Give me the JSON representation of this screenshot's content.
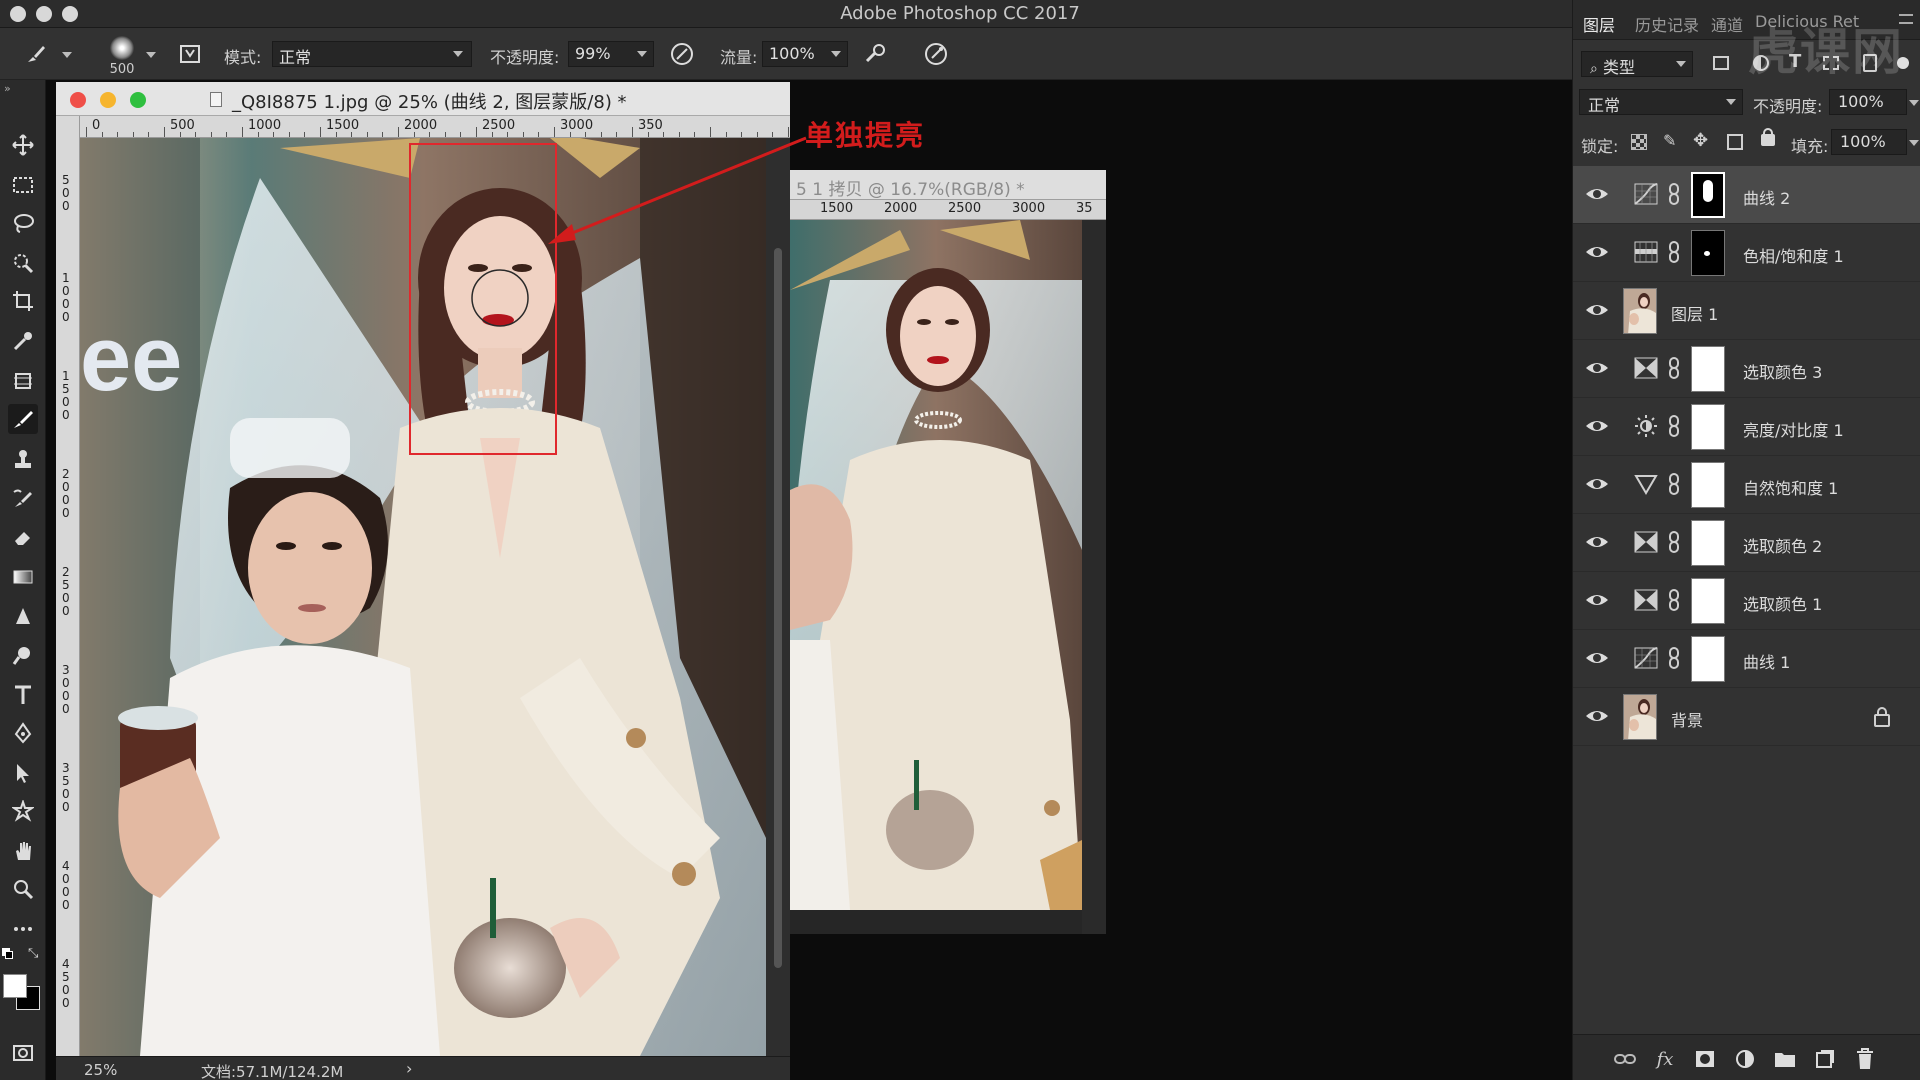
{
  "window": {
    "app_title": "Adobe Photoshop CC 2017"
  },
  "options_bar": {
    "brush_size": "500",
    "mode_label": "模式:",
    "mode_value": "正常",
    "opacity_label": "不透明度:",
    "opacity_value": "99%",
    "flow_label": "流量:",
    "flow_value": "100%"
  },
  "document_main": {
    "tab_title": "_Q8I8875 1.jpg @ 25% (曲线 2, 图层蒙版/8) *",
    "ruler_h_labels": [
      "0",
      "500",
      "1000",
      "1500",
      "2000",
      "2500",
      "3000",
      "350"
    ],
    "ruler_v_labels": [
      "5\n0\n0",
      "1\n0\n0\n0",
      "1\n5\n0\n0",
      "2\n0\n0\n0",
      "2\n5\n0\n0",
      "3\n0\n0\n0",
      "3\n5\n0\n0",
      "4\n0\n0\n0",
      "4\n5\n0\n0"
    ],
    "status_zoom": "25%",
    "status_doc": "文档:57.1M/124.2M",
    "status_arrow": "›"
  },
  "annotation": {
    "text": "单独提亮",
    "color": "#d21c1c"
  },
  "document_second": {
    "tab_title": "5 1 拷贝 @ 16.7%(RGB/8) *",
    "ruler_labels": [
      "1500",
      "2000",
      "2500",
      "3000",
      "35"
    ]
  },
  "layers_panel": {
    "tabs": [
      {
        "label": "图层",
        "active": true
      },
      {
        "label": "历史记录",
        "active": false
      },
      {
        "label": "通道",
        "active": false
      },
      {
        "label": "Delicious Ret",
        "active": false
      }
    ],
    "filter_label": "类型",
    "blend_mode": "正常",
    "opacity_label": "不透明度:",
    "opacity_value": "100%",
    "lock_label": "锁定:",
    "fill_label": "填充:",
    "fill_value": "100%",
    "layers": [
      {
        "name": "曲线 2",
        "type": "curves",
        "mask": "dark-with-face",
        "selected": true
      },
      {
        "name": "色相/饱和度 1",
        "type": "hue-saturation",
        "mask": "dark-with-dot",
        "selected": false
      },
      {
        "name": "图层 1",
        "type": "photo",
        "mask": "none",
        "selected": false
      },
      {
        "name": "选取颜色 3",
        "type": "selective-color",
        "mask": "white",
        "selected": false
      },
      {
        "name": "亮度/对比度 1",
        "type": "brightness-contrast",
        "mask": "white",
        "selected": false
      },
      {
        "name": "自然饱和度 1",
        "type": "vibrance",
        "mask": "white",
        "selected": false
      },
      {
        "name": "选取颜色 2",
        "type": "selective-color",
        "mask": "white",
        "selected": false
      },
      {
        "name": "选取颜色 1",
        "type": "selective-color",
        "mask": "white",
        "selected": false
      },
      {
        "name": "曲线 1",
        "type": "curves",
        "mask": "white",
        "selected": false
      },
      {
        "name": "背景",
        "type": "photo",
        "mask": "none",
        "locked": true,
        "selected": false
      }
    ]
  },
  "watermark": {
    "text": "虎课网"
  },
  "colors": {
    "accent_red": "#d21c1c",
    "panel_bg": "#323232",
    "selected_row": "#4a4a4a"
  }
}
